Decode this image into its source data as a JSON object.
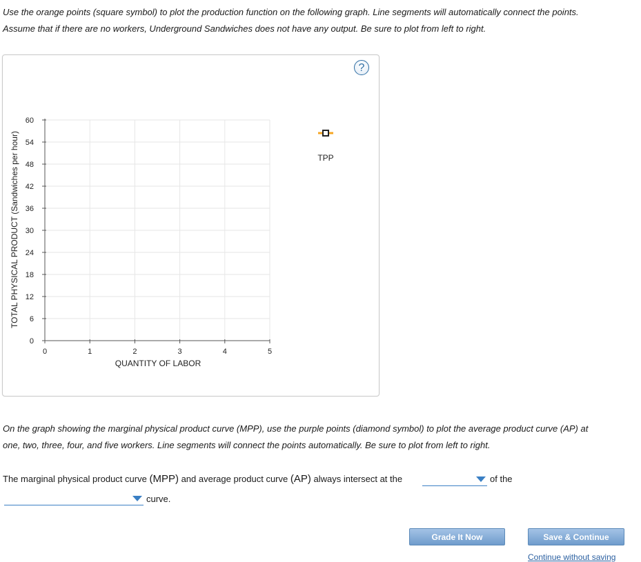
{
  "instructions": {
    "line1": "Use the orange points (square symbol) to plot the production function on the following graph. Line segments will automatically connect the points.",
    "line2": "Assume that if there are no workers, Underground Sandwiches does not have any output. Be sure to plot from left to right.",
    "line3": "On the graph showing the marginal physical product curve (MPP), use the purple points (diamond symbol) to plot the average product curve (AP) at",
    "line4": "one, two, three, four, and five workers. Line segments will connect the points automatically. Be sure to plot from left to right."
  },
  "graph": {
    "help_label": "?",
    "legend_label": "TPP",
    "colors": {
      "tpp_orange": "#f5a623",
      "grid": "#e6e6e6",
      "axis": "#555555",
      "help_blue": "#2d6da3"
    }
  },
  "chart_data": {
    "type": "line",
    "xlabel": "QUANTITY OF LABOR",
    "ylabel": "TOTAL PHYSICAL PRODUCT (Sandwiches per hour)",
    "xlim": [
      0,
      5
    ],
    "ylim": [
      0,
      60
    ],
    "x_ticks": [
      "0",
      "1",
      "2",
      "3",
      "4",
      "5"
    ],
    "y_ticks": [
      "0",
      "6",
      "12",
      "18",
      "24",
      "30",
      "36",
      "42",
      "48",
      "54",
      "60"
    ],
    "grid": true,
    "legend": "top-right",
    "series": [
      {
        "name": "TPP",
        "marker": "square",
        "color": "#f5a623",
        "points": []
      }
    ]
  },
  "question": {
    "prefix": "The marginal physical product curve",
    "mpp": "(MPP)",
    "and": "and average product curve",
    "ap": "(AP)",
    "suffix": "always intersect at the",
    "after_dropdown1": "of the",
    "after_dropdown2": "curve.",
    "dropdown1_value": "",
    "dropdown2_value": ""
  },
  "buttons": {
    "grade": "Grade It Now",
    "save": "Save & Continue",
    "continue_link": "Continue without saving"
  }
}
